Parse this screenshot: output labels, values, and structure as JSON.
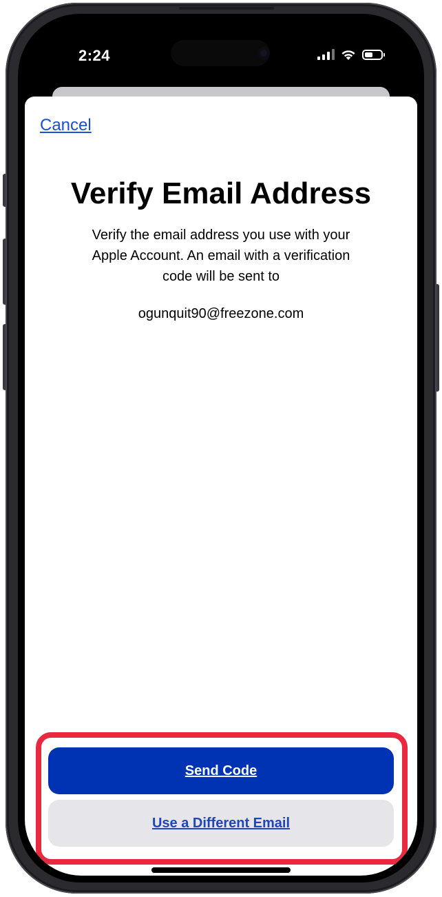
{
  "status_bar": {
    "time": "2:24",
    "battery_level": 0.5,
    "cellular_icon": "signal-bars-icon",
    "wifi_icon": "wifi-icon",
    "battery_icon": "battery-icon"
  },
  "sheet": {
    "cancel_label": "Cancel",
    "title": "Verify Email Address",
    "description": "Verify the email address you use with your Apple Account. An email with a verification code will be sent to",
    "email": "ogunquit90@freezone.com"
  },
  "actions": {
    "send_code_label": "Send Code",
    "different_email_label": "Use a Different Email"
  },
  "colors": {
    "primary_button": "#0033b4",
    "secondary_button": "#e5e5ea",
    "link": "#1a4fd6",
    "highlight": "#e8293f"
  }
}
